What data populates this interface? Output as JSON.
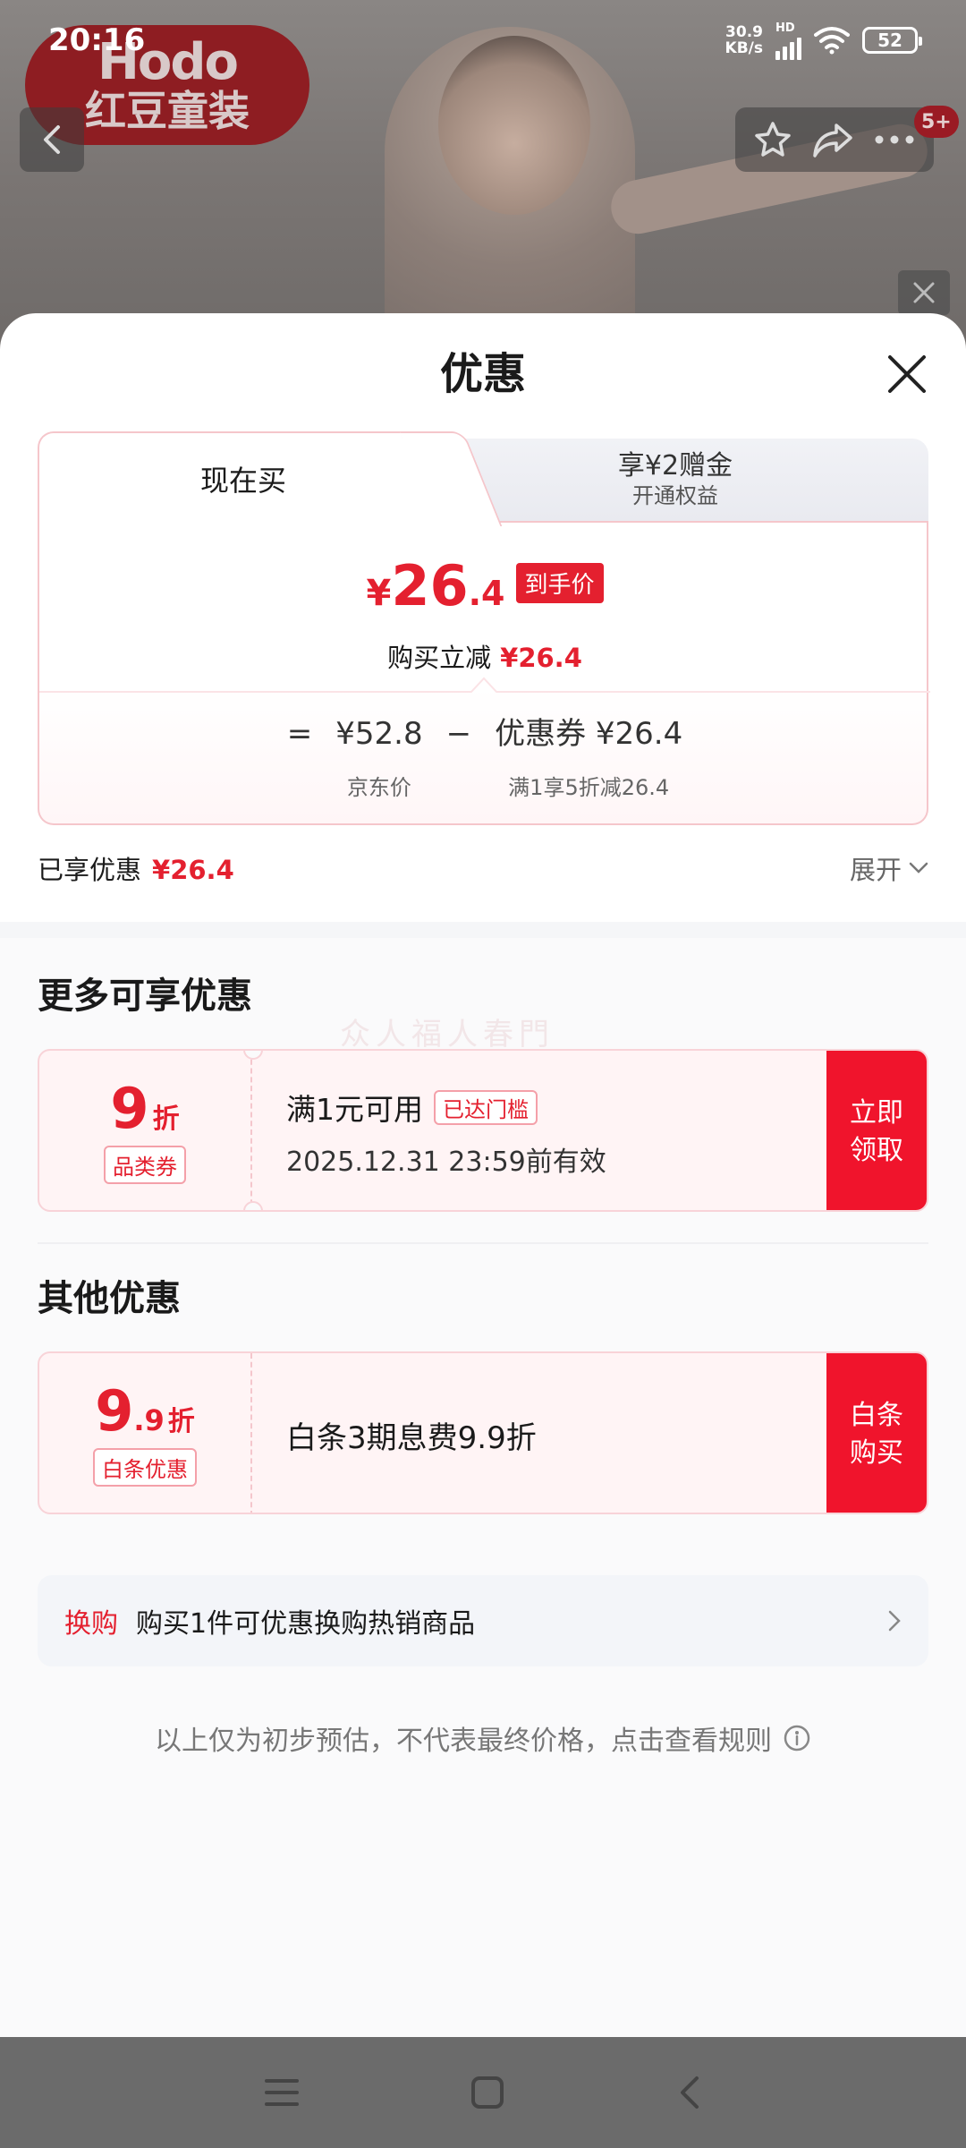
{
  "status_bar": {
    "time": "20:16",
    "net_speed_value": "30.9",
    "net_speed_unit": "KB/s",
    "hd": "HD",
    "battery": "52"
  },
  "background": {
    "brand_en": "Hodo",
    "brand_cn": "红豆童装",
    "msg_badge": "5+"
  },
  "sheet": {
    "title": "优惠",
    "tabs": {
      "active": "现在买",
      "other_line1": "享¥2赠金",
      "other_line2": "开通权益"
    },
    "final": {
      "currency": "¥",
      "integer": "26",
      "decimal": ".4",
      "tag": "到手价"
    },
    "instant": {
      "label": "购买立减",
      "value": "¥26.4"
    },
    "formula": {
      "equals": "=",
      "jd_price": "¥52.8",
      "jd_label": "京东价",
      "minus": "−",
      "coupon_value": "优惠券 ¥26.4",
      "coupon_label": "满1享5折减26.4"
    },
    "enjoyed": {
      "label": "已享优惠",
      "value": "¥26.4",
      "expand": "展开"
    },
    "watermark": "众人福人春門",
    "more_section": {
      "title": "更多可享优惠",
      "coupon": {
        "discount_num": "9",
        "discount_unit": "折",
        "category": "品类券",
        "condition": "满1元可用",
        "reached": "已达门槛",
        "valid": "2025.12.31 23:59前有效",
        "button": "立即领取"
      }
    },
    "other_section": {
      "title": "其他优惠",
      "coupon": {
        "discount_num": "9",
        "discount_dec": ".9",
        "discount_unit": "折",
        "category": "白条优惠",
        "desc": "白条3期息费9.9折",
        "button": "白条购买"
      }
    },
    "exchange": {
      "tag": "换购",
      "text": "购买1件可优惠换购热销商品"
    },
    "disclaimer": "以上仅为初步预估，不代表最终价格，点击查看规则"
  },
  "colors": {
    "accent_red": "#e4202f",
    "button_red": "#f0142c",
    "coupon_bg": "#fff4f5"
  }
}
